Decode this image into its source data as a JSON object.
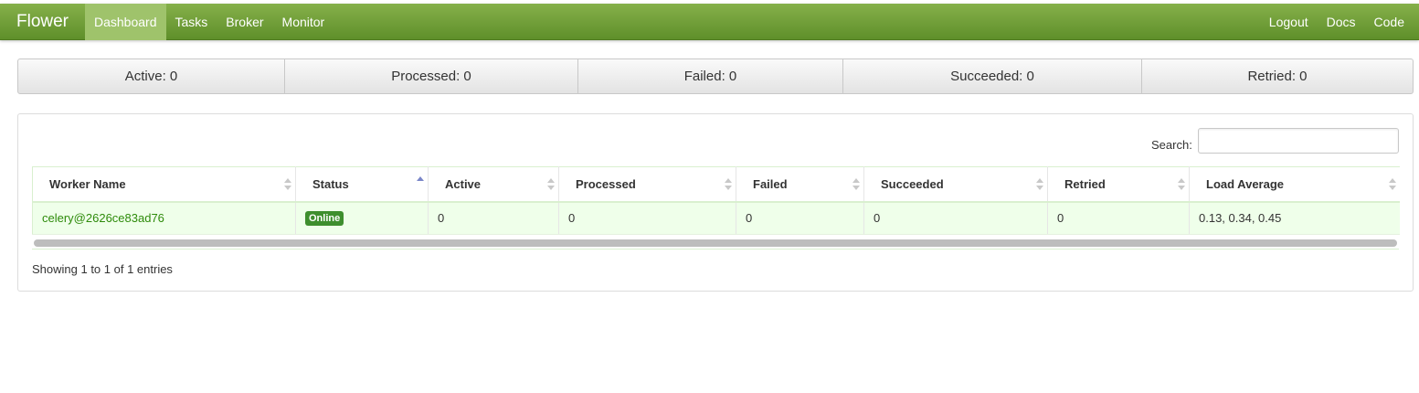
{
  "navbar": {
    "brand": "Flower",
    "left_items": [
      "Dashboard",
      "Tasks",
      "Broker",
      "Monitor"
    ],
    "active_item": "Dashboard",
    "right_items": [
      "Logout",
      "Docs",
      "Code"
    ]
  },
  "stats": [
    {
      "label": "Active: 0"
    },
    {
      "label": "Processed: 0"
    },
    {
      "label": "Failed: 0"
    },
    {
      "label": "Succeeded: 0"
    },
    {
      "label": "Retried: 0"
    }
  ],
  "search": {
    "label": "Search:",
    "value": ""
  },
  "table": {
    "columns": [
      "Worker Name",
      "Status",
      "Active",
      "Processed",
      "Failed",
      "Succeeded",
      "Retried",
      "Load Average"
    ],
    "sorted_column": "Status",
    "sort_direction": "asc",
    "rows": [
      {
        "worker_name": "celery@2626ce83ad76",
        "status": "Online",
        "active": "0",
        "processed": "0",
        "failed": "0",
        "succeeded": "0",
        "retried": "0",
        "load_average": "0.13, 0.34, 0.45"
      }
    ]
  },
  "info": "Showing 1 to 1 of 1 entries",
  "colors": {
    "navbar_top": "#86b04a",
    "navbar_bottom": "#5f8f2a",
    "active_nav": "#9fc36b",
    "row_bg": "#efffea",
    "link": "#2e8b0b",
    "badge": "#3e8e2e"
  }
}
